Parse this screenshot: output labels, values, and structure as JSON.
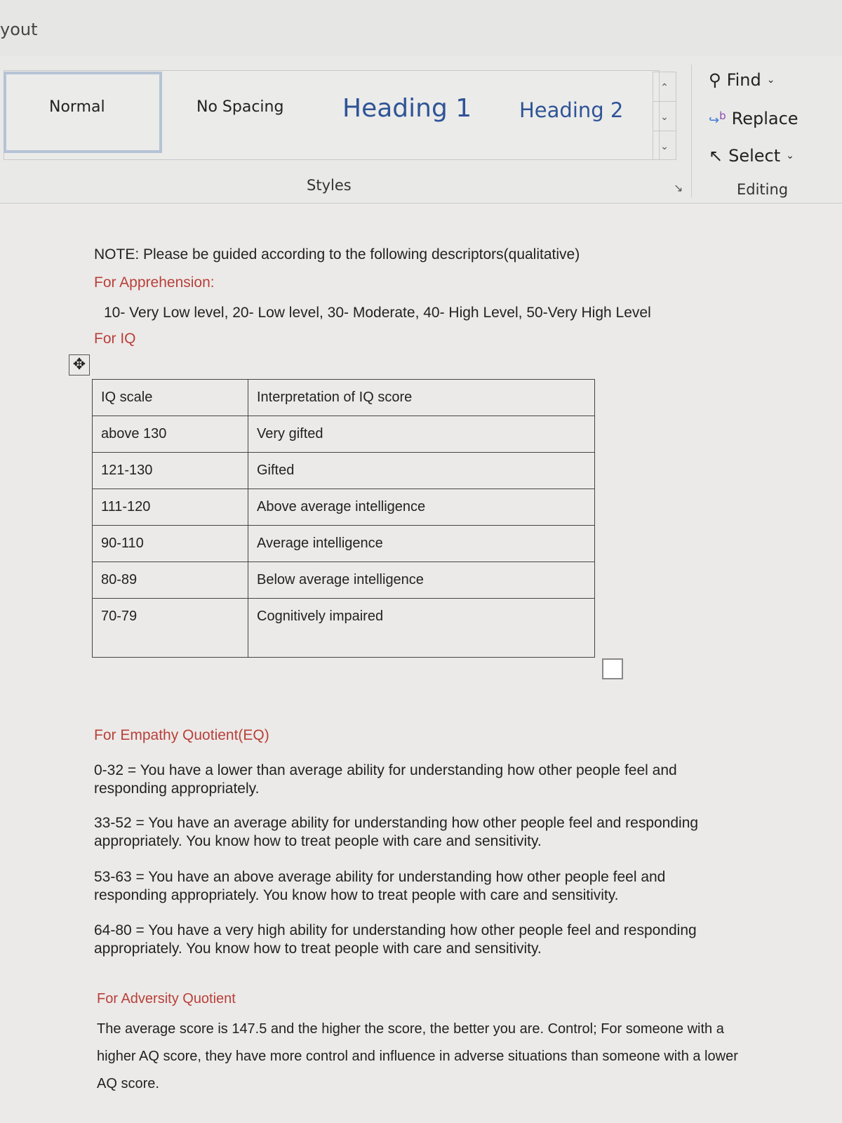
{
  "ribbon": {
    "tab_fragment": "yout",
    "styles": [
      "Normal",
      "No Spacing",
      "Heading 1",
      "Heading 2"
    ],
    "styles_group_label": "Styles",
    "editing": {
      "find": "Find",
      "replace": "Replace",
      "select": "Select",
      "group_label": "Editing"
    }
  },
  "doc": {
    "note": "NOTE: Please be guided according to the following descriptors(qualitative)",
    "apprehension_heading": "For Apprehension:",
    "apprehension_levels": "10- Very Low level, 20- Low level, 30- Moderate, 40- High Level, 50-Very High Level",
    "iq_heading": "For IQ",
    "iq_table": {
      "headers": [
        "IQ scale",
        "Interpretation of IQ score"
      ],
      "rows": [
        [
          "above 130",
          "Very gifted"
        ],
        [
          "121-130",
          "Gifted"
        ],
        [
          "111-120",
          "Above average intelligence"
        ],
        [
          "90-110",
          "Average intelligence"
        ],
        [
          "80-89",
          "Below average intelligence"
        ],
        [
          "70-79",
          "Cognitively impaired"
        ]
      ]
    },
    "eq_heading": "For Empathy Quotient(EQ)",
    "eq_items": [
      "0-32 = You have a lower than average ability for understanding how other people feel and responding appropriately.",
      "33-52 = You have an average ability for understanding how other people feel and responding appropriately. You know how to treat people with care and sensitivity.",
      "53-63 = You have an above average ability for understanding how other people feel and responding appropriately. You know how to treat people with care and sensitivity.",
      "64-80 = You have a very high ability for understanding how other people feel and responding appropriately. You know how to treat people with care and sensitivity."
    ],
    "aq_heading": "For Adversity Quotient",
    "aq_text": "The average score is 147.5 and the higher the score, the better you are. Control; For someone with a higher AQ score, they have more control and influence in adverse situations than someone with a lower AQ score."
  }
}
